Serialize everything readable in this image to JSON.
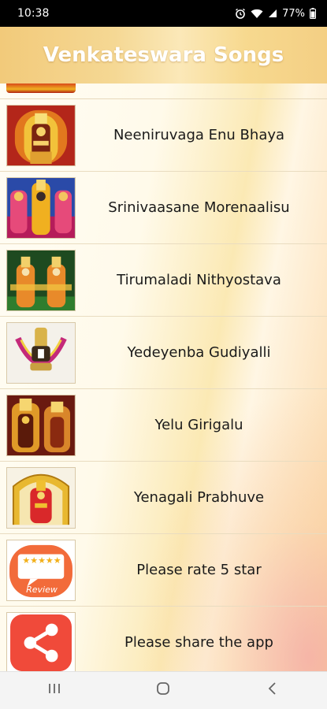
{
  "status_bar": {
    "time": "10:38",
    "battery": "77%",
    "icons": [
      "alarm-icon",
      "wifi-icon",
      "signal-icon",
      "battery-icon"
    ]
  },
  "app": {
    "title": "Venkateswara Songs"
  },
  "songs": [
    {
      "label": "Neeniruvaga Enu Bhaya",
      "thumbnail": "deity-image-red"
    },
    {
      "label": "Srinivaasane Morenaalisu",
      "thumbnail": "deity-image-trio"
    },
    {
      "label": "Tirumaladi Nithyostava",
      "thumbnail": "deity-image-green"
    },
    {
      "label": "Yedeyenba Gudiyalli",
      "thumbnail": "deity-image-garland"
    },
    {
      "label": "Yelu Girigalu",
      "thumbnail": "deity-image-pair"
    },
    {
      "label": "Yenagali Prabhuve",
      "thumbnail": "deity-image-temple"
    }
  ],
  "actions": {
    "rate_label": "Please rate 5 star",
    "rate_badge": "Review",
    "rate_stars": "★★★★★",
    "share_label": "Please share the app"
  },
  "colors": {
    "header": "#f4cf84",
    "share_red": "#f04a3a",
    "review_orange": "#f26b3a"
  },
  "nav": [
    "recents-icon",
    "home-icon",
    "back-icon"
  ]
}
